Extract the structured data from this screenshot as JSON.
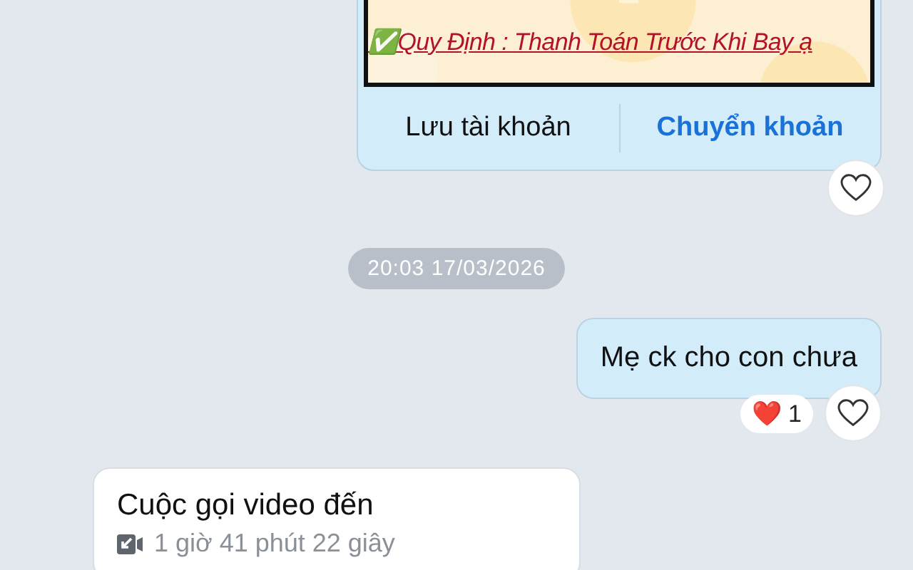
{
  "transfer_card": {
    "banner_text": "✅Quy Định : Thanh Toán Trước Khi Bay ạ",
    "actions": [
      {
        "label": "Lưu tài khoản",
        "kind": "plain"
      },
      {
        "label": "Chuyển khoản",
        "kind": "primary"
      }
    ]
  },
  "timestamp": "20:03 17/03/2026",
  "outgoing_message": {
    "text": "Mẹ ck cho con chưa",
    "reaction_emoji": "❤️",
    "reaction_count": "1"
  },
  "call_card": {
    "title": "Cuộc gọi video đến",
    "duration": "1 giờ 41 phút 22 giây"
  }
}
